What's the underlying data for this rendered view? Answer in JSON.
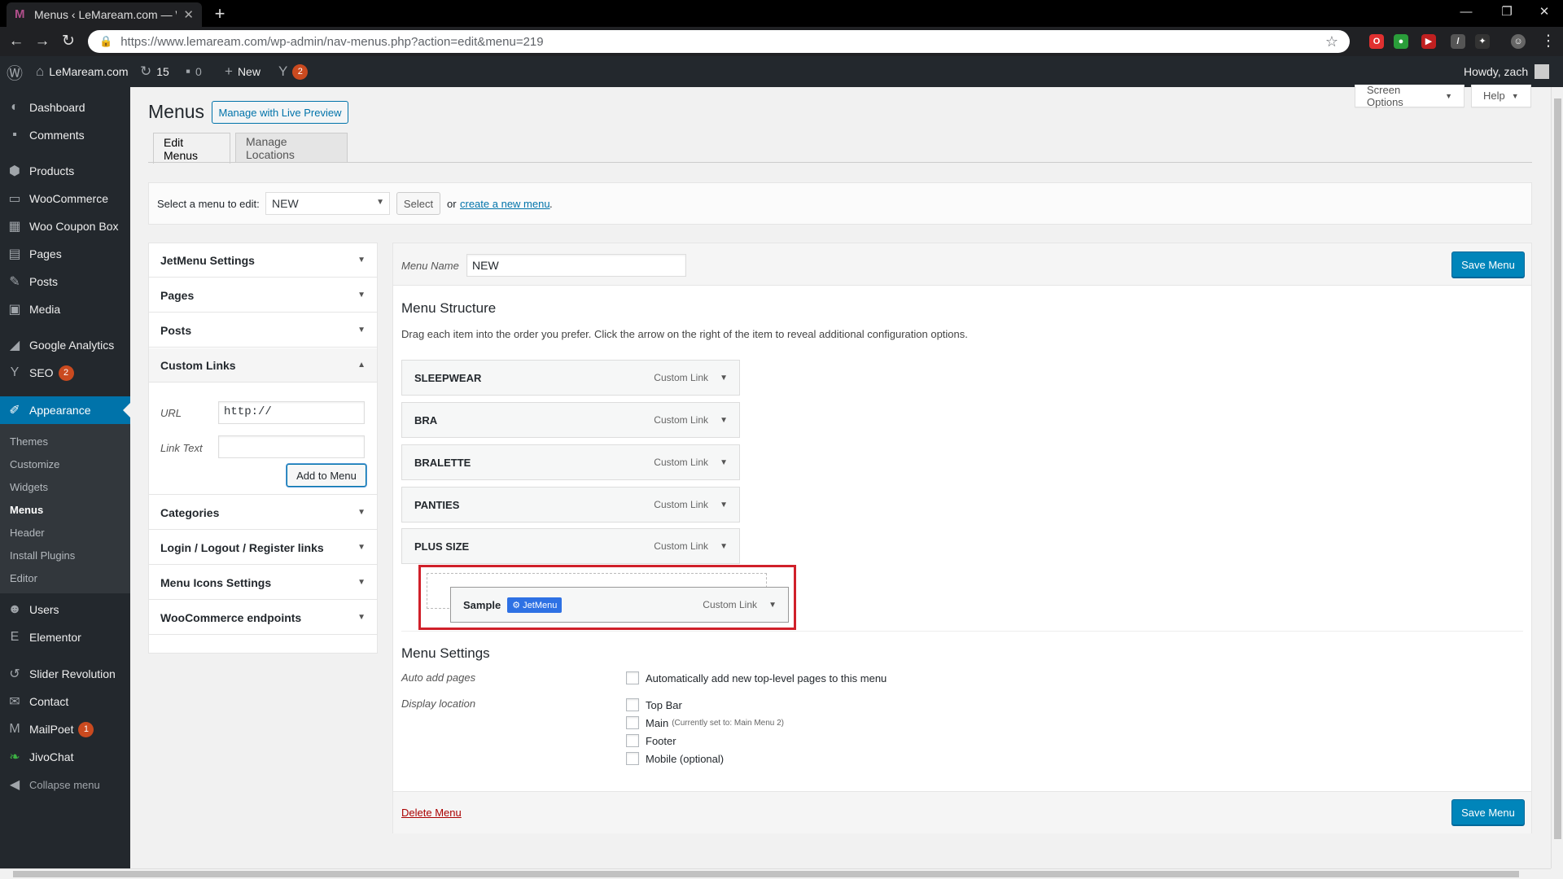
{
  "browser": {
    "tab_title": "Menus ‹ LeMaream.com — Word",
    "url": "https://www.lemaream.com/wp-admin/nav-menus.php?action=edit&menu=219"
  },
  "adminbar": {
    "site_name": "LeMaream.com",
    "updates_count": "15",
    "comments_count": "0",
    "new_label": "New",
    "yoast_count": "2",
    "howdy": "Howdy, zach"
  },
  "sidebar": {
    "items": [
      {
        "label": "Dashboard",
        "icon": "dashboard-icon"
      },
      {
        "label": "Comments",
        "icon": "comments-icon"
      },
      {
        "label": "Products",
        "icon": "products-icon"
      },
      {
        "label": "WooCommerce",
        "icon": "woocommerce-icon"
      },
      {
        "label": "Woo Coupon Box",
        "icon": "coupon-icon"
      },
      {
        "label": "Pages",
        "icon": "pages-icon"
      },
      {
        "label": "Posts",
        "icon": "posts-icon"
      },
      {
        "label": "Media",
        "icon": "media-icon"
      },
      {
        "label": "Google Analytics",
        "icon": "analytics-icon"
      },
      {
        "label": "SEO",
        "icon": "seo-icon",
        "badge": "2"
      },
      {
        "label": "Appearance",
        "icon": "appearance-icon"
      },
      {
        "label": "Users",
        "icon": "users-icon"
      },
      {
        "label": "Elementor",
        "icon": "elementor-icon"
      },
      {
        "label": "Slider Revolution",
        "icon": "slider-icon"
      },
      {
        "label": "Contact",
        "icon": "contact-icon"
      },
      {
        "label": "MailPoet",
        "icon": "mailpoet-icon",
        "badge": "1"
      },
      {
        "label": "JivoChat",
        "icon": "jivochat-icon"
      },
      {
        "label": "Collapse menu",
        "icon": "collapse-icon"
      }
    ],
    "submenu": [
      "Themes",
      "Customize",
      "Widgets",
      "Menus",
      "Header",
      "Install Plugins",
      "Editor"
    ]
  },
  "header": {
    "title": "Menus",
    "live_preview": "Manage with Live Preview",
    "screen_options": "Screen Options",
    "help": "Help",
    "tabs": [
      "Edit Menus",
      "Manage Locations"
    ]
  },
  "manage": {
    "label": "Select a menu to edit:",
    "selected": "NEW",
    "select_button": "Select",
    "or_text": "or",
    "create_link": "create a new menu",
    "period": "."
  },
  "accordion": {
    "sections": [
      "JetMenu Settings",
      "Pages",
      "Posts",
      "Custom Links",
      "Categories",
      "Login / Logout / Register links",
      "Menu Icons Settings",
      "WooCommerce endpoints"
    ],
    "url_label": "URL",
    "url_value": "http://",
    "link_text_label": "Link Text",
    "link_text_value": "",
    "add_button": "Add to Menu"
  },
  "editor": {
    "menu_name_label": "Menu Name",
    "menu_name_value": "NEW",
    "save_button": "Save Menu",
    "structure_title": "Menu Structure",
    "structure_help": "Drag each item into the order you prefer. Click the arrow on the right of the item to reveal additional configuration options.",
    "items": [
      {
        "label": "SLEEPWEAR",
        "type": "Custom Link"
      },
      {
        "label": "BRA",
        "type": "Custom Link"
      },
      {
        "label": "BRALETTE",
        "type": "Custom Link"
      },
      {
        "label": "PANTIES",
        "type": "Custom Link"
      },
      {
        "label": "PLUS SIZE",
        "type": "Custom Link"
      }
    ],
    "sub_item": {
      "label": "Sample",
      "badge": "JetMenu",
      "type": "Custom Link"
    },
    "settings_title": "Menu Settings",
    "auto_add_label": "Auto add pages",
    "auto_add_text": "Automatically add new top-level pages to this menu",
    "display_location_label": "Display location",
    "locations": [
      {
        "label": "Top Bar",
        "note": ""
      },
      {
        "label": "Main",
        "note": "(Currently set to: Main Menu 2)"
      },
      {
        "label": "Footer",
        "note": ""
      },
      {
        "label": "Mobile (optional)",
        "note": ""
      }
    ],
    "delete_link": "Delete Menu"
  },
  "colors": {
    "accent": "#0073aa",
    "primary_button": "#0085ba",
    "highlight_border": "#d0202a",
    "jetmenu_badge": "#2e71e4"
  }
}
